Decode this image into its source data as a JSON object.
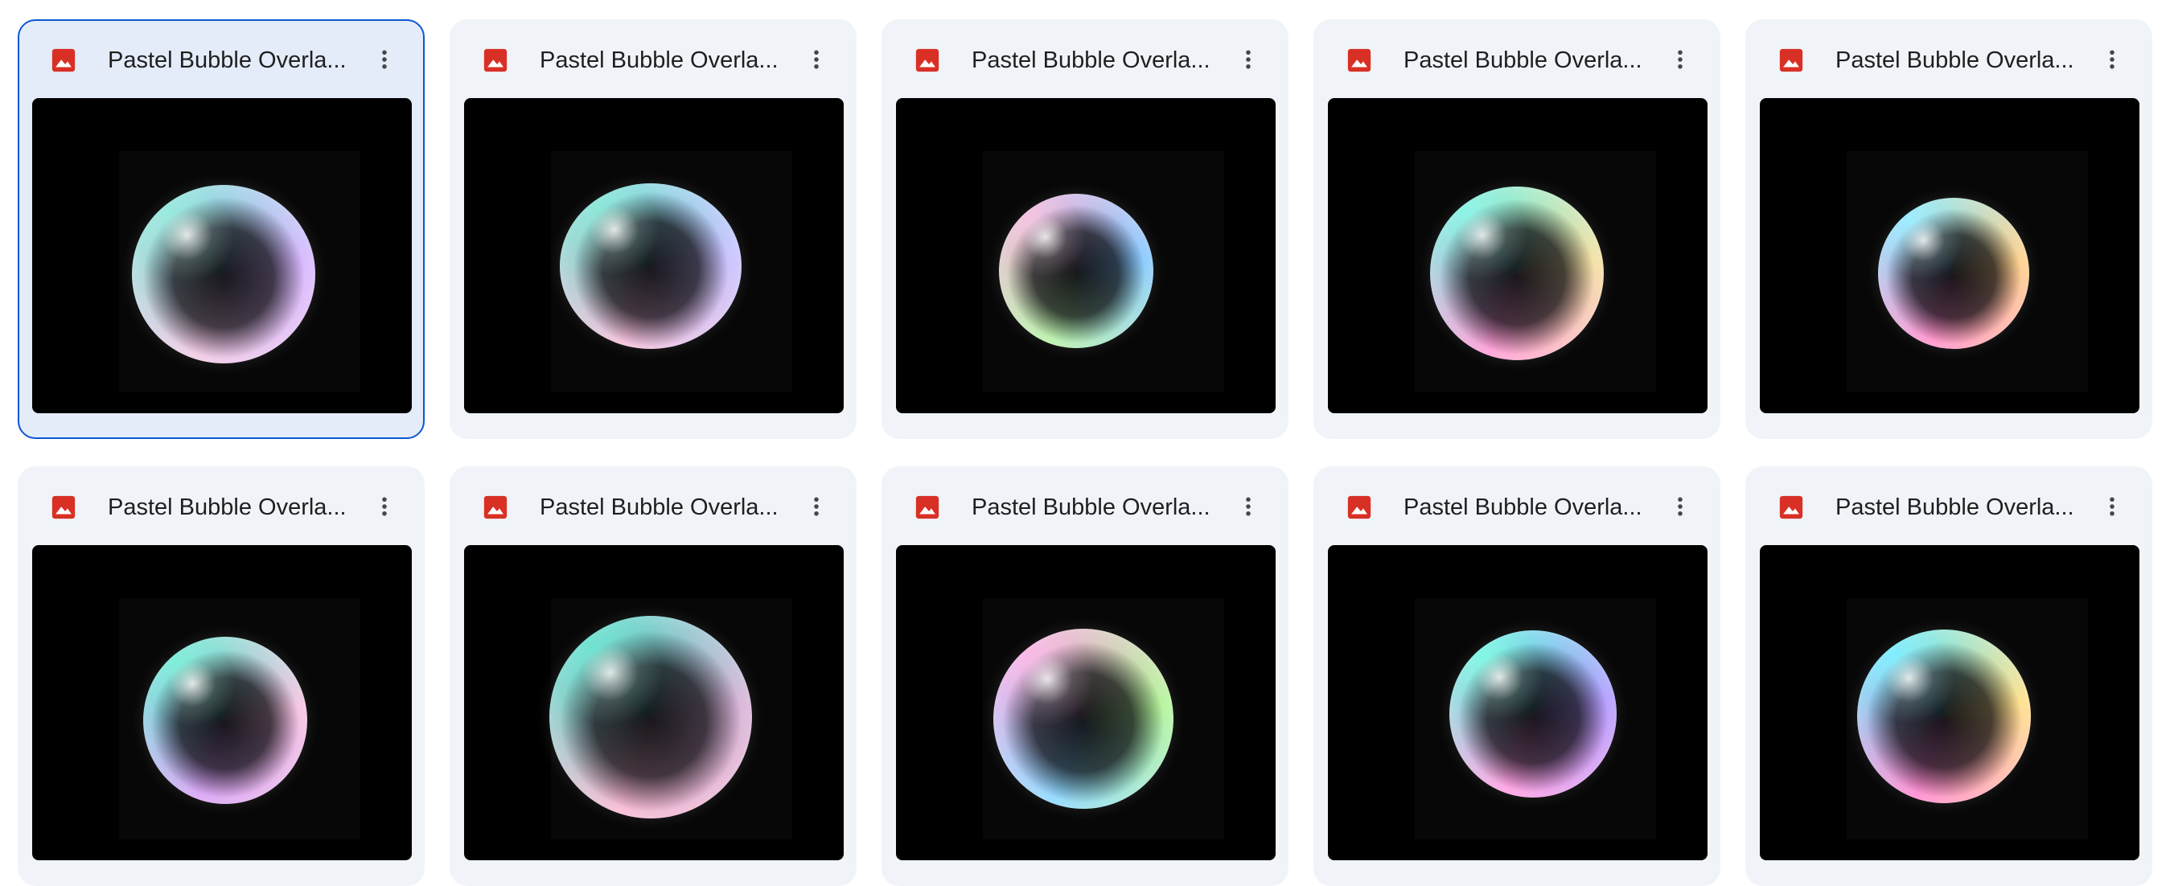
{
  "files": [
    {
      "name": "Pastel Bubble Overla...",
      "type_icon": "image-file-icon",
      "selected": true,
      "bubble": {
        "c1": "#f1c9e4",
        "c2": "#7fe3d6",
        "c3": "#d8b8ff"
      }
    },
    {
      "name": "Pastel Bubble Overla...",
      "type_icon": "image-file-icon",
      "selected": false,
      "bubble": {
        "c1": "#f3bcd8",
        "c2": "#6fe0cf",
        "c3": "#c7c3ff"
      }
    },
    {
      "name": "Pastel Bubble Overla...",
      "type_icon": "image-file-icon",
      "selected": false,
      "bubble": {
        "c1": "#b7f0a7",
        "c2": "#f0b3d8",
        "c3": "#87c9ff"
      }
    },
    {
      "name": "Pastel Bubble Overla...",
      "type_icon": "image-file-icon",
      "selected": false,
      "bubble": {
        "c1": "#ff9bd6",
        "c2": "#6ff0e0",
        "c3": "#f3e0a3"
      }
    },
    {
      "name": "Pastel Bubble Overla...",
      "type_icon": "image-file-icon",
      "selected": false,
      "bubble": {
        "c1": "#ff8fca",
        "c2": "#82e7ff",
        "c3": "#ffd089"
      }
    },
    {
      "name": "Pastel Bubble Overla...",
      "type_icon": "image-file-icon",
      "selected": false,
      "bubble": {
        "c1": "#d7a2f4",
        "c2": "#5ee8d0",
        "c3": "#f5c2e1"
      }
    },
    {
      "name": "Pastel Bubble Overla...",
      "type_icon": "image-file-icon",
      "selected": false,
      "bubble": {
        "c1": "#f7b8d2",
        "c2": "#4fdcc7",
        "c3": "#d7b5d8"
      }
    },
    {
      "name": "Pastel Bubble Overla...",
      "type_icon": "image-file-icon",
      "selected": false,
      "bubble": {
        "c1": "#8dd8ff",
        "c2": "#f8a8e0",
        "c3": "#b5f59a"
      }
    },
    {
      "name": "Pastel Bubble Overla...",
      "type_icon": "image-file-icon",
      "selected": false,
      "bubble": {
        "c1": "#ff9ee0",
        "c2": "#61f5de",
        "c3": "#b39cff"
      }
    },
    {
      "name": "Pastel Bubble Overla...",
      "type_icon": "image-file-icon",
      "selected": false,
      "bubble": {
        "c1": "#ff88cf",
        "c2": "#61e9ff",
        "c3": "#ffe08a"
      }
    }
  ],
  "icons": {
    "file_type": "image-file-icon",
    "menu": "more-vert-icon"
  },
  "colors": {
    "card_bg": "#f0f4f9",
    "selected_border": "#0b57d0",
    "image_icon": "#d93025",
    "thumb_bg": "#000000"
  }
}
